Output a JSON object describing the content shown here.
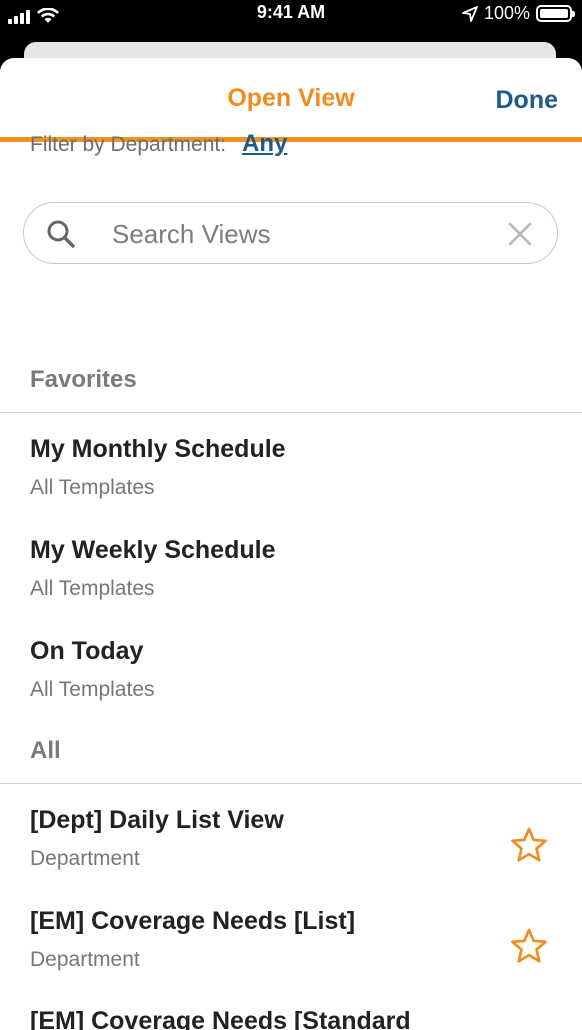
{
  "status_bar": {
    "time": "9:41 AM",
    "battery": "100%"
  },
  "nav": {
    "title": "Open View",
    "done_label": "Done"
  },
  "filter": {
    "label": "Filter by Department:",
    "value": "Any"
  },
  "search": {
    "placeholder": "Search Views",
    "value": ""
  },
  "sections": {
    "favorites": {
      "title": "Favorites",
      "items": [
        {
          "title": "My Monthly Schedule",
          "subtitle": "All Templates"
        },
        {
          "title": "My Weekly Schedule",
          "subtitle": "All Templates"
        },
        {
          "title": "On Today",
          "subtitle": "All Templates"
        }
      ]
    },
    "all": {
      "title": "All",
      "items": [
        {
          "title": "[Dept] Daily List View",
          "subtitle": "Department",
          "icon": "star-outline-icon"
        },
        {
          "title": "[EM] Coverage Needs [List]",
          "subtitle": "Department",
          "icon": "star-outline-icon"
        },
        {
          "title": "[EM] Coverage Needs [Standard",
          "subtitle": ""
        }
      ]
    }
  },
  "colors": {
    "accent_orange": "#f28c1f",
    "link_blue": "#1f5a8c"
  }
}
